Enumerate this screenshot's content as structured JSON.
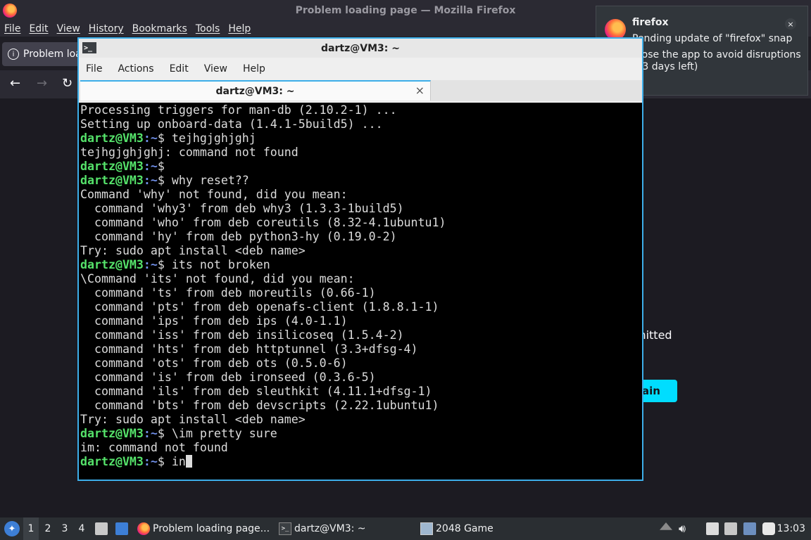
{
  "firefox": {
    "window_title": "Problem loading page — Mozilla Firefox",
    "menu": [
      "File",
      "Edit",
      "View",
      "History",
      "Bookmarks",
      "Tools",
      "Help"
    ],
    "tab_title": "Problem loading page",
    "content_partial_text": "mitted",
    "content_button_partial": "ain"
  },
  "notification": {
    "app": "firefox",
    "close": "×",
    "message": "Pending update of \"firefox\" snap",
    "detail": "Close the app to avoid disruptions (13 days left)"
  },
  "terminal": {
    "window_title": "dartz@VM3: ~",
    "menu": [
      "File",
      "Actions",
      "Edit",
      "View",
      "Help"
    ],
    "tab_title": "dartz@VM3: ~",
    "tab_close": "×",
    "prompt_user": "dartz@VM3",
    "prompt_path": ":~",
    "prompt_symbol": "$",
    "lines": [
      {
        "type": "out",
        "text": "Processing triggers for man-db (2.10.2-1) ..."
      },
      {
        "type": "out",
        "text": "Setting up onboard-data (1.4.1-5build5) ..."
      },
      {
        "type": "cmd",
        "text": " tejhgjghjghj"
      },
      {
        "type": "out",
        "text": "tejhgjghjghj: command not found"
      },
      {
        "type": "cmd",
        "text": ""
      },
      {
        "type": "cmd",
        "text": " why reset??"
      },
      {
        "type": "out",
        "text": "Command 'why' not found, did you mean:"
      },
      {
        "type": "out",
        "text": "  command 'why3' from deb why3 (1.3.3-1build5)"
      },
      {
        "type": "out",
        "text": "  command 'who' from deb coreutils (8.32-4.1ubuntu1)"
      },
      {
        "type": "out",
        "text": "  command 'hy' from deb python3-hy (0.19.0-2)"
      },
      {
        "type": "out",
        "text": "Try: sudo apt install <deb name>"
      },
      {
        "type": "cmd",
        "text": " its not broken"
      },
      {
        "type": "out",
        "text": "\\Command 'its' not found, did you mean:"
      },
      {
        "type": "out",
        "text": "  command 'ts' from deb moreutils (0.66-1)"
      },
      {
        "type": "out",
        "text": "  command 'pts' from deb openafs-client (1.8.8.1-1)"
      },
      {
        "type": "out",
        "text": "  command 'ips' from deb ips (4.0-1.1)"
      },
      {
        "type": "out",
        "text": "  command 'iss' from deb insilicoseq (1.5.4-2)"
      },
      {
        "type": "out",
        "text": "  command 'hts' from deb httptunnel (3.3+dfsg-4)"
      },
      {
        "type": "out",
        "text": "  command 'ots' from deb ots (0.5.0-6)"
      },
      {
        "type": "out",
        "text": "  command 'is' from deb ironseed (0.3.6-5)"
      },
      {
        "type": "out",
        "text": "  command 'ils' from deb sleuthkit (4.11.1+dfsg-1)"
      },
      {
        "type": "out",
        "text": "  command 'bts' from deb devscripts (2.22.1ubuntu1)"
      },
      {
        "type": "out",
        "text": "Try: sudo apt install <deb name>"
      },
      {
        "type": "cmd",
        "text": " \\im pretty sure"
      },
      {
        "type": "out",
        "text": "im: command not found"
      },
      {
        "type": "cmd",
        "text": " in",
        "cursor": true
      }
    ]
  },
  "taskbar": {
    "workspaces": [
      "1",
      "2",
      "3",
      "4"
    ],
    "tasks": [
      {
        "label": "Problem loading page...",
        "icon": "firefox-icon"
      },
      {
        "label": "dartz@VM3: ~",
        "icon": "terminal-icon"
      },
      {
        "label": "2048 Game",
        "icon": "window-icon"
      }
    ],
    "clock": "13:03"
  },
  "colors": {
    "accent": "#3daee9",
    "prompt_user": "#55e26a",
    "prompt_path": "#6f8ee6",
    "ff_button": "#00ddff"
  }
}
